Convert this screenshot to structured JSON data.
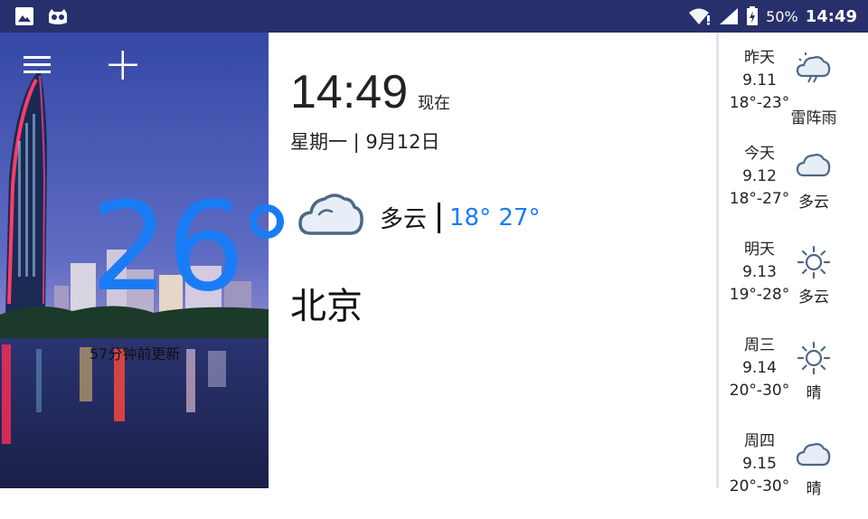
{
  "status_bar": {
    "left_icons": [
      "image-icon",
      "cyanogen-mascot-icon"
    ],
    "right_icons": [
      "wifi-icon",
      "signal-icon",
      "battery-icon"
    ],
    "battery_percent": "50%",
    "time": "14:49",
    "bg_color": "#27306b"
  },
  "toolbar": {
    "menu_icon": "hamburger-menu-icon",
    "add_icon": "plus-icon"
  },
  "current": {
    "temperature": "26",
    "updated": "57分钟前更新",
    "time": "14:49",
    "now_label": "现在",
    "date": "星期一 | 9月12日",
    "condition": "多云",
    "range": "18° 27°",
    "city": "北京",
    "icon": "cloud-icon",
    "accent_color": "#1a7cf5"
  },
  "forecast": [
    {
      "day": "昨天",
      "date": "9.11",
      "range": "18°-23°",
      "condition": "雷阵雨",
      "icon": "thunder-shower-icon"
    },
    {
      "day": "今天",
      "date": "9.12",
      "range": "18°-27°",
      "condition": "多云",
      "icon": "cloud-icon"
    },
    {
      "day": "明天",
      "date": "9.13",
      "range": "19°-28°",
      "condition": "多云",
      "icon": "sun-icon"
    },
    {
      "day": "周三",
      "date": "9.14",
      "range": "20°-30°",
      "condition": "晴",
      "icon": "sun-icon"
    },
    {
      "day": "周四",
      "date": "9.15",
      "range": "20°-30°",
      "condition": "晴",
      "icon": "cloud-icon"
    }
  ]
}
